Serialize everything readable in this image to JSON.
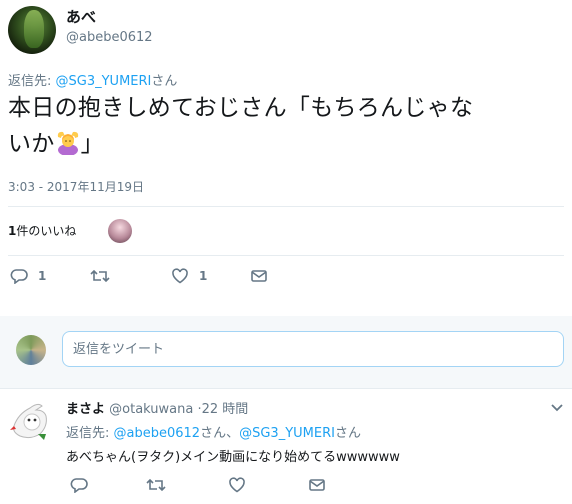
{
  "tweet": {
    "display_name": "あべ",
    "handle": "@abebe0612",
    "reply_prefix": "返信先: ",
    "reply_mention": "@SG3_YUMERI",
    "reply_suffix": "さん",
    "text_line1": "本日の抱きしめておじさん「もちろんじゃな",
    "text_line2_pre": "いか",
    "text_line2_post": "」",
    "emoji_icon": "person-gesturing-ok-emoji",
    "timestamp": "3:03 - 2017年11月19日",
    "likes_count": "1",
    "likes_label": "件のいいね",
    "actions": {
      "reply_count": "1",
      "retweet_count": "",
      "like_count": "1"
    }
  },
  "reply_box": {
    "placeholder": "返信をツイート"
  },
  "reply_tweet": {
    "display_name": "まさよ",
    "handle": "@otakuwana",
    "time": "·22 時間",
    "reply_prefix": "返信先: ",
    "mention1": "@abebe0612",
    "mention_sep": "さん、",
    "mention2": "@SG3_YUMERI",
    "mention_suffix": "さん",
    "text": "あべちゃん(ヲタク)メイン動画になり始めてるwwwwww"
  },
  "colors": {
    "link": "#1da1f2",
    "muted": "#657786",
    "border": "#e6ecf0"
  }
}
